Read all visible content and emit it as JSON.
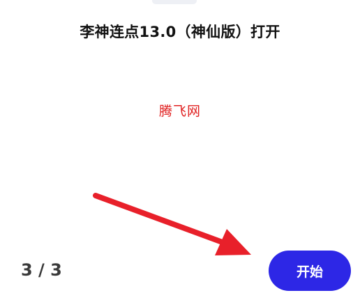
{
  "title": "李神连点13.0（神仙版）打开",
  "watermark": "腾飞网",
  "pager": {
    "counter": "3 / 3"
  },
  "actions": {
    "start_label": "开始"
  },
  "annotation": {
    "arrow_color": "#e8202a"
  },
  "colors": {
    "primary_button": "#2d27e6",
    "title_text": "#111111",
    "watermark_text": "#e02020",
    "counter_text": "#3a3a3a"
  }
}
